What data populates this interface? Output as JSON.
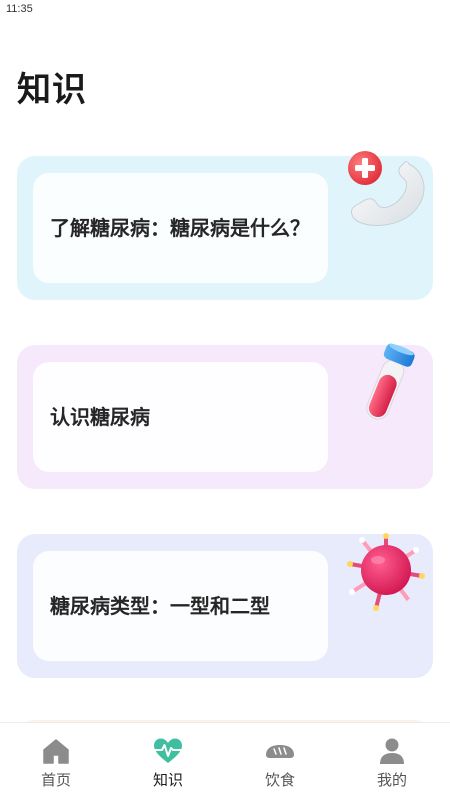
{
  "status_bar": {
    "time": "11:35"
  },
  "page": {
    "title": "知识"
  },
  "articles": [
    {
      "title": "了解糖尿病：糖尿病是什么？",
      "illustration": "phone-medical-icon",
      "bg": "#dff4fb"
    },
    {
      "title": "认识糖尿病",
      "illustration": "test-tube-icon",
      "bg": "#f5e9fb"
    },
    {
      "title": "糖尿病类型：一型和二型",
      "illustration": "virus-icon",
      "bg": "#e7ebfc"
    }
  ],
  "bottom_nav": {
    "active": "知识",
    "accent": "#3fbf9f",
    "items": [
      {
        "label": "首页",
        "icon": "home-icon"
      },
      {
        "label": "知识",
        "icon": "heartbeat-icon"
      },
      {
        "label": "饮食",
        "icon": "bread-icon"
      },
      {
        "label": "我的",
        "icon": "user-icon"
      }
    ]
  }
}
